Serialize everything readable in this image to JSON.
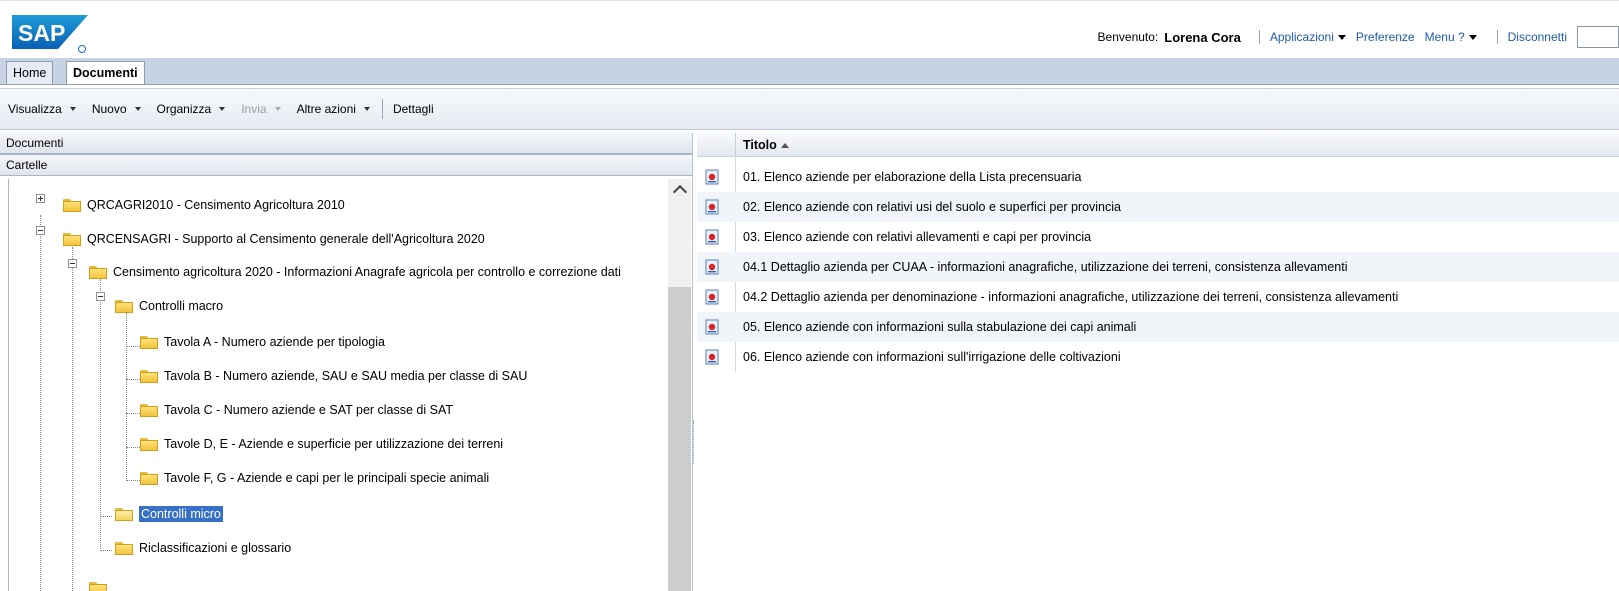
{
  "header": {
    "logo_text": "SAP",
    "welcome_label": "Benvenuto:",
    "user_name": "Lorena Cora",
    "links": {
      "applicazioni": "Applicazioni",
      "preferenze": "Preferenze",
      "menu": "Menu ?",
      "disconnetti": "Disconnetti"
    }
  },
  "tabs": [
    {
      "label": "Home",
      "active": false
    },
    {
      "label": "Documenti",
      "active": true
    }
  ],
  "toolbar": {
    "visualizza": "Visualizza",
    "nuovo": "Nuovo",
    "organizza": "Organizza",
    "invia": "Invia",
    "altre_azioni": "Altre azioni",
    "dettagli": "Dettagli"
  },
  "left_panel": {
    "documenti_header": "Documenti",
    "cartelle_header": "Cartelle",
    "tree": [
      {
        "label": "QRCAGRI2010 - Censimento Agricoltura 2010",
        "expander": "plus"
      },
      {
        "label": "QRCENSAGRI - Supporto al Censimento generale dell'Agricoltura 2020",
        "expander": "minus"
      },
      {
        "label": "Censimento agricoltura 2020 - Informazioni Anagrafe agricola per controllo e correzione dati",
        "expander": "minus"
      },
      {
        "label": "Controlli macro",
        "expander": "minus"
      },
      {
        "label": "Tavola A - Numero aziende per tipologia"
      },
      {
        "label": "Tavola B - Numero aziende, SAU e SAU media per classe di SAU"
      },
      {
        "label": "Tavola C - Numero aziende e SAT per classe di SAT"
      },
      {
        "label": "Tavole D, E - Aziende e superficie per utilizzazione dei terreni"
      },
      {
        "label": "Tavole F, G - Aziende e capi per le principali specie animali"
      },
      {
        "label": "Controlli micro",
        "selected": true
      },
      {
        "label": "Riclassificazioni e glossario"
      }
    ]
  },
  "right_panel": {
    "column_title": "Titolo",
    "rows": [
      "01. Elenco aziende per elaborazione della Lista precensuaria",
      "02. Elenco aziende con relativi usi del suolo e superfici per provincia",
      "03. Elenco aziende con relativi allevamenti e capi per provincia",
      "04.1 Dettaglio azienda per CUAA - informazioni anagrafiche, utilizzazione dei terreni, consistenza allevamenti",
      "04.2 Dettaglio azienda per denominazione - informazioni anagrafiche, utilizzazione dei terreni, consistenza allevamenti",
      "05. Elenco aziende con informazioni sulla stabulazione dei capi animali",
      "06. Elenco aziende con informazioni sull'irrigazione delle coltivazioni"
    ]
  },
  "colors": {
    "accent_blue": "#1e5ba8",
    "selection": "#3870c8",
    "tabbar": "#c7d2e2",
    "folder": "#f2c33c"
  }
}
